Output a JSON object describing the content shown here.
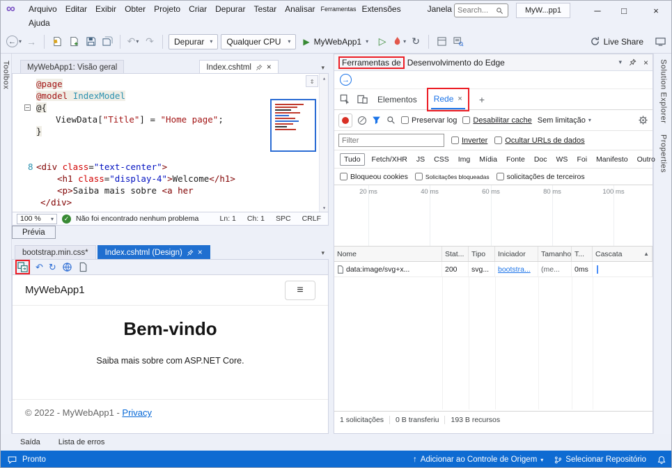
{
  "colors": {
    "status_bar_blue": "#0e6bd2",
    "active_tab_blue": "#1f6fd0",
    "annotation_red": "#ec1c24",
    "link_blue": "#1a73e8",
    "run_green": "#388a34",
    "logo_purple": "#7b52c4"
  },
  "titlebar": {
    "menus": [
      "Arquivo",
      "Editar",
      "Exibir",
      "Obter",
      "Projeto",
      "Criar",
      "Depurar",
      "Testar",
      "Analisar",
      "Ferramentas",
      "Extensões",
      "Janela"
    ],
    "menu_help": "Ajuda",
    "search_placeholder": "Search...",
    "window_title": "MyW...pp1"
  },
  "toolbar": {
    "debug_config": "Depurar",
    "platform": "Qualquer CPU",
    "run_target": "MyWebApp1",
    "live_share": "Live Share"
  },
  "strips": {
    "toolbox": "Toolbox",
    "solution_explorer": "Solution Explorer",
    "properties": "Properties"
  },
  "editor": {
    "tab_overview": "MyWebApp1: Visão geral",
    "tab_index": "Index.cshtml",
    "zoom": "100 %",
    "status_message": "Não foi encontrado nenhum problema",
    "ln": "Ln: 1",
    "ch": "Ch: 1",
    "spc": "SPC",
    "crlf": "CRLF",
    "preview_button": "Prévia",
    "code": {
      "l1": {
        "d": "@page"
      },
      "l2": {
        "d": "@model ",
        "t": "IndexModel"
      },
      "l3": {
        "p": "@{"
      },
      "l4": {
        "p1": "ViewData[",
        "s1": "\"Title\"",
        "p2": "] = ",
        "s2": "\"Home page\"",
        "p3": ";"
      },
      "l5": {
        "p": "}"
      },
      "l8": {
        "num": "8",
        "a": "<",
        "tag": "div",
        "attr": " class",
        "eq": "=",
        "val": "\"text-center\"",
        "b": ">"
      },
      "l9": {
        "a": "<",
        "tag": "h1",
        "attr": " class",
        "eq": "=",
        "val": "\"display-4\"",
        "b": ">",
        "text": "Welcome",
        "c": "</",
        "tag2": "h1",
        "d": ">"
      },
      "l10": {
        "a": "<",
        "tag": "p",
        "b": ">",
        "text": "Saiba mais sobre ",
        "c": "<",
        "tag2": "a her"
      },
      "l11": {
        "a": "</",
        "tag": "div",
        "b": ">"
      }
    }
  },
  "design": {
    "tab_css": "bootstrap.min.css*",
    "tab_design": "Index.cshtml (Design)",
    "preview": {
      "brand": "MyWebApp1",
      "heading": "Bem-vindo",
      "subtext": "Saiba mais sobre com ASP.NET Core.",
      "footer_prefix": "© 2022 - MyWebApp1 - ",
      "footer_link": "Privacy"
    }
  },
  "devtools": {
    "title_highlighted": "Ferramentas de",
    "title_rest": "Desenvolvimento do Edge",
    "tab_elements": "Elementos",
    "tab_network": "Rede",
    "net_toolbar": {
      "preserve_log": "Preservar log",
      "disable_cache": "Desabilitar cache",
      "throttling": "Sem limitação"
    },
    "filter_row": {
      "placeholder": "Filter",
      "invert": "Inverter",
      "hide_data_urls": "Ocultar URLs de dados"
    },
    "chips": [
      "Tudo",
      "Fetch/XHR",
      "JS",
      "CSS",
      "Img",
      "Mídia",
      "Fonte",
      "Doc",
      "WS",
      "Foi",
      "Manifesto",
      "Outro"
    ],
    "checks": {
      "blocked_cookies": "Bloqueou cookies",
      "blocked_requests": "Solicitações bloqueadas",
      "third_party": "solicitações de terceiros"
    },
    "timeline": [
      "20 ms",
      "40 ms",
      "60 ms",
      "80 ms",
      "100 ms"
    ],
    "table": {
      "headers": [
        "Nome",
        "Stat...",
        "Tipo",
        "Iniciador",
        "Tamanho...",
        "T...",
        "Cascata"
      ],
      "row": {
        "name": "data:image/svg+x...",
        "status": "200",
        "type": "svg...",
        "initiator": "bootstra...",
        "size": "(me...",
        "time": "0ms"
      }
    },
    "summary": {
      "requests": "1 solicitações",
      "transferred": "0 B transferiu",
      "resources": "193 B recursos"
    }
  },
  "bottom": {
    "output": "Saída",
    "error_list": "Lista de erros"
  },
  "statusbar": {
    "ready": "Pronto",
    "add_source_control": "Adicionar ao Controle de Origem",
    "select_repo": "Selecionar Repositório"
  },
  "icons": {
    "logo": "∞",
    "back": "←",
    "forward": "→",
    "undo": "↶",
    "redo": "↷",
    "dropdown": "▾",
    "run": "▶",
    "run_outline": "▷",
    "restart": "↻",
    "minimize": "─",
    "maximize": "□",
    "close": "×",
    "hamburger": "≡",
    "check": "✓",
    "sort_asc": "▲",
    "scroll_up": "▴",
    "scroll_down": "▾",
    "splitter": "⇕",
    "plus": "+",
    "tab_close": "×",
    "arrow_right": "→",
    "up_arrow": "↑"
  }
}
